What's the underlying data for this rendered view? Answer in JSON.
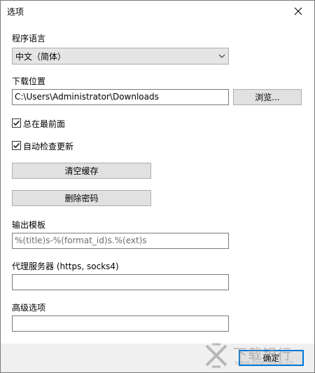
{
  "window": {
    "title": "选项"
  },
  "language": {
    "label": "程序语言",
    "selected": "中文（简体）"
  },
  "download": {
    "label": "下载位置",
    "path": "C:\\Users\\Administrator\\Downloads",
    "browse_label": "浏览..."
  },
  "options": {
    "always_on_top": {
      "label": "总在最前面",
      "checked": true
    },
    "auto_update": {
      "label": "自动检查更新",
      "checked": true
    }
  },
  "actions": {
    "clear_cache_label": "清空缓存",
    "delete_password_label": "删除密码"
  },
  "output_template": {
    "label": "输出模板",
    "placeholder": "%(title)s-%(format_id)s.%(ext)s"
  },
  "proxy": {
    "label": "代理服务器 (https, socks4)",
    "value": ""
  },
  "advanced": {
    "label": "高级选项",
    "value": ""
  },
  "footer": {
    "ok_label": "确定"
  },
  "watermark": {
    "text": "下载银行",
    "url": "www.downbank.cn"
  },
  "colors": {
    "focus_border": "#0078d7",
    "button_face": "#e1e1e1",
    "footer_bg": "#f0f0f0"
  }
}
